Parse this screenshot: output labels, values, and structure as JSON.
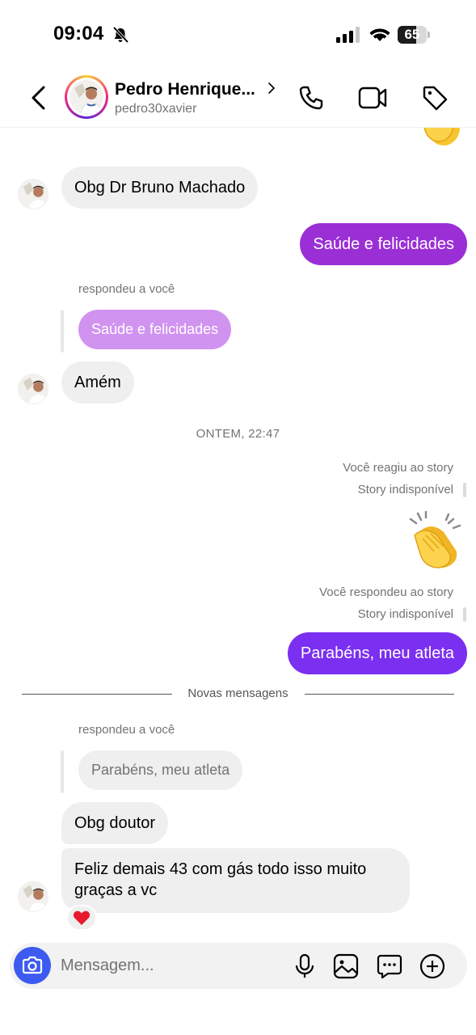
{
  "status_bar": {
    "time": "09:04",
    "battery": "65",
    "battery_level": 0.65
  },
  "header": {
    "name": "Pedro Henrique...",
    "username": "pedro30xavier"
  },
  "messages": {
    "m1": "Obg Dr Bruno Machado",
    "m2": "Saúde e felicidades",
    "reply1_label": "respondeu a você",
    "reply1_quote": "Saúde e felicidades",
    "m3": "Amém",
    "timestamp": "ONTEM, 22:47",
    "story_reaction_label": "Você reagiu ao story",
    "story_unavailable_1": "Story indisponível",
    "story_reply_label": "Você respondeu ao story",
    "story_unavailable_2": "Story indisponível",
    "m4": "Parabéns, meu atleta",
    "new_messages": "Novas mensagens",
    "reply2_label": "respondeu a você",
    "reply2_quote": "Parabéns, meu atleta",
    "m5": "Obg doutor",
    "m6_line1": "Feliz demais 43 com gás todo isso muito",
    "m6_line2": "graças a vc",
    "reaction": "heart"
  },
  "composer": {
    "placeholder": "Mensagem..."
  },
  "colors": {
    "outgoing_1": "#9b2fd6",
    "outgoing_2": "#7b2ff0",
    "quote_outgoing": "#d193f0",
    "camera": "#3d5af1"
  }
}
